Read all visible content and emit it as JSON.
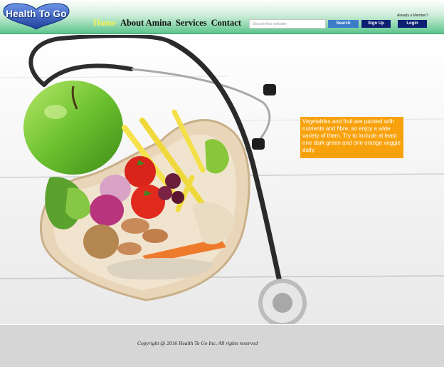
{
  "header": {
    "logo_text": "Health To Go",
    "nav": [
      {
        "label": "Home",
        "active": true
      },
      {
        "label": "About Amina",
        "active": false
      },
      {
        "label": "Services",
        "active": false
      },
      {
        "label": "Contact",
        "active": false
      }
    ],
    "search": {
      "placeholder": "Search this website",
      "value": ""
    },
    "search_button": "Search",
    "signup_button": "Sign Up",
    "member_text": "Already a Member?",
    "login_button": "Login"
  },
  "hero": {
    "callout_text": "Vegetables and fruit are packed with nutrients and fibre, so enjoy a wide variety of them. Try to include at least one dark green and one orange veggie daily."
  },
  "footer": {
    "copyright": "Copyright @ 2016 Health To Go Inc, All rights reserved"
  },
  "colors": {
    "header_gradient_start": "#ffffff",
    "header_gradient_end": "#5cc58d",
    "nav_active": "#f2f25a",
    "search_button": "#3d7dc8",
    "account_buttons": "#0c1f73",
    "callout_background": "#f7a20d",
    "footer_background": "#d6d6d6"
  }
}
